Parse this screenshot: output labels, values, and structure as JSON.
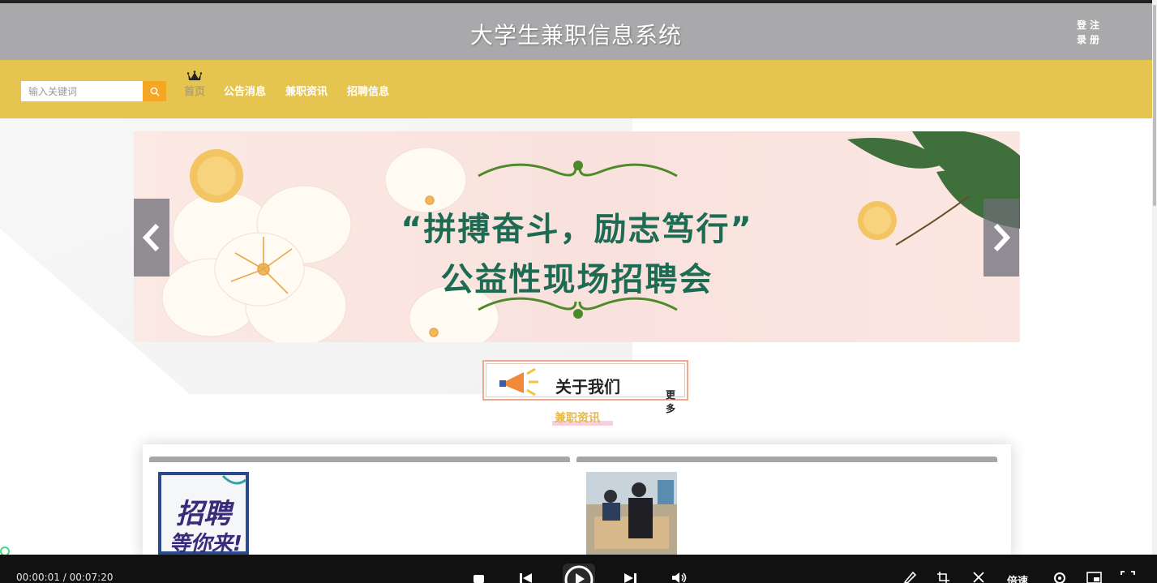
{
  "header": {
    "title": "大学生兼职信息系统",
    "login": "登录",
    "register": "注册",
    "login_chars": [
      "登",
      "录"
    ],
    "register_chars": [
      "注",
      "册"
    ]
  },
  "search": {
    "placeholder": "输入关键词"
  },
  "nav": {
    "items": [
      {
        "label": "首页",
        "active": true
      },
      {
        "label": "公告消息"
      },
      {
        "label": "兼职资讯"
      },
      {
        "label": "招聘信息"
      }
    ]
  },
  "banner": {
    "line1": "“拼搏奋斗，励志笃行”",
    "line2": "公益性现场招聘会"
  },
  "about": {
    "title": "关于我们",
    "more": "更多"
  },
  "section": {
    "label": "兼职资讯"
  },
  "thumbs": {
    "first_line1": "招聘",
    "first_line2": "等你来!"
  },
  "player": {
    "time": "00:00:01 / 00:07:20",
    "speed_label": "倍速"
  },
  "colors": {
    "header_bg": "#a9a9ab",
    "navbar_bg": "#e5c44f",
    "search_btn": "#f5a623",
    "banner_text": "#1e6b54",
    "section_label": "#e6b84a"
  }
}
